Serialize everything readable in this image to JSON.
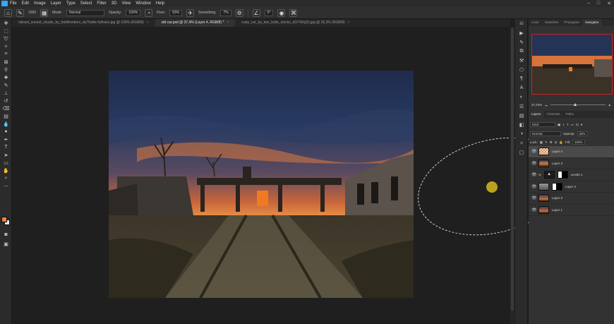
{
  "menubar": {
    "items": [
      "File",
      "Edit",
      "Image",
      "Layer",
      "Type",
      "Select",
      "Filter",
      "3D",
      "View",
      "Window",
      "Help"
    ]
  },
  "options": {
    "brush_size": "1000",
    "mode_label": "Mode:",
    "mode_value": "Normal",
    "opacity_label": "Opacity:",
    "opacity_value": "100%",
    "flow_label": "Flow:",
    "flow_value": "93%",
    "smoothing_label": "Smoothing:",
    "smoothing_value": "7%",
    "angle_value": "0°"
  },
  "tabs": [
    {
      "label": "vibrant_sunset_clouds_by_boldfrontiers_du7hwke fulhsize.jpg @ 100% (RGB/8)",
      "active": false
    },
    {
      "label": "old car.psd @ 37,4% (Layer 4, RGB/8) *",
      "active": true
    },
    {
      "label": "rusty_car_by_two_bolts_stocks_d1f742q(2).jpg @ 33,3% (RGB/8)",
      "active": false
    }
  ],
  "panel": {
    "top_tabs": [
      "Color",
      "Swatches",
      "Photogram",
      "Navigator"
    ],
    "zoom_value": "37,43%",
    "layers_tabs": [
      "Layers",
      "Channels",
      "Paths"
    ],
    "kind_label": "Kind",
    "blend_mode": "Normal",
    "opacity_label": "Opacity:",
    "opacity_value": "32%",
    "lock_label": "Lock:",
    "fill_label": "Fill:",
    "fill_value": "100%",
    "layers": [
      {
        "name": "Layer 4",
        "thumb": "checker",
        "selected": true
      },
      {
        "name": "Layer 3",
        "thumb": "photo",
        "selected": false
      },
      {
        "name": "Levels 1",
        "thumb": "levels",
        "selected": false
      },
      {
        "name": "Layer 2",
        "thumb": "gray",
        "selected": false
      },
      {
        "name": "Layer 2",
        "thumb": "sky",
        "selected": false
      },
      {
        "name": "Layer 1",
        "thumb": "sky",
        "selected": false
      }
    ]
  },
  "colors": {
    "foreground": "#e8843e",
    "background": "#e9e9e9",
    "brush_center": "#bba21e"
  }
}
